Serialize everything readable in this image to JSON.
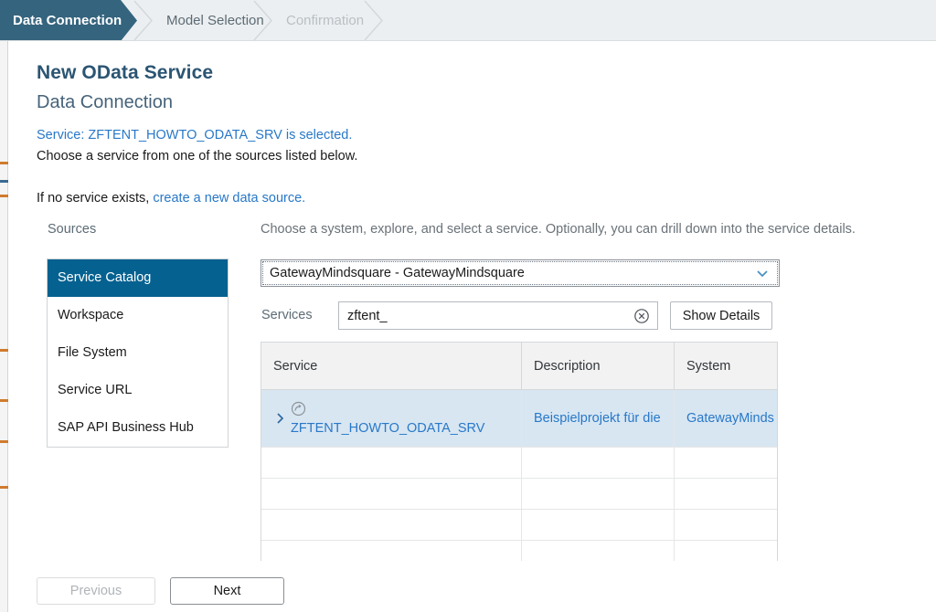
{
  "wizard": {
    "steps": [
      {
        "label": "Data Connection",
        "state": "active"
      },
      {
        "label": "Model Selection",
        "state": "inactive"
      },
      {
        "label": "Confirmation",
        "state": "disabled"
      }
    ]
  },
  "page": {
    "title": "New OData Service",
    "subtitle": "Data Connection",
    "selected_message": "Service: ZFTENT_HOWTO_ODATA_SRV is selected.",
    "instruction": "Choose a service from one of the sources listed below.",
    "no_service_prefix": "If no service exists,",
    "no_service_link": "create a new data source.",
    "sources_label": "Sources",
    "right_hint": "Choose a system, explore, and select a service. Optionally, you can drill down into the service details."
  },
  "sources": {
    "items": [
      {
        "label": "Service Catalog",
        "selected": true
      },
      {
        "label": "Workspace",
        "selected": false
      },
      {
        "label": "File System",
        "selected": false
      },
      {
        "label": "Service URL",
        "selected": false
      },
      {
        "label": "SAP API Business Hub",
        "selected": false
      }
    ]
  },
  "system_select": {
    "value": "GatewayMindsquare - GatewayMindsquare",
    "caret_icon": "chevron-down-icon"
  },
  "services_search": {
    "label": "Services",
    "value": "zftent_",
    "placeholder": "",
    "clear_icon": "circle-close-icon",
    "details_button": "Show Details"
  },
  "table": {
    "columns": [
      "Service",
      "Description",
      "System"
    ],
    "rows": [
      {
        "service": "ZFTENT_HOWTO_ODATA_SRV",
        "description": "Beispielprojekt für die",
        "system": "GatewayMinds",
        "selected": true,
        "expander_icon": "chevron-right-icon",
        "service_icon": "circle-arrow-right-icon"
      }
    ],
    "empty_row_count": 4
  },
  "footer": {
    "previous_label": "Previous",
    "next_label": "Next"
  },
  "colors": {
    "active_step": "#35647e",
    "selected_source": "#056190",
    "link": "#2878c8",
    "selected_row": "#d8e6f2",
    "title": "#2b5573"
  }
}
